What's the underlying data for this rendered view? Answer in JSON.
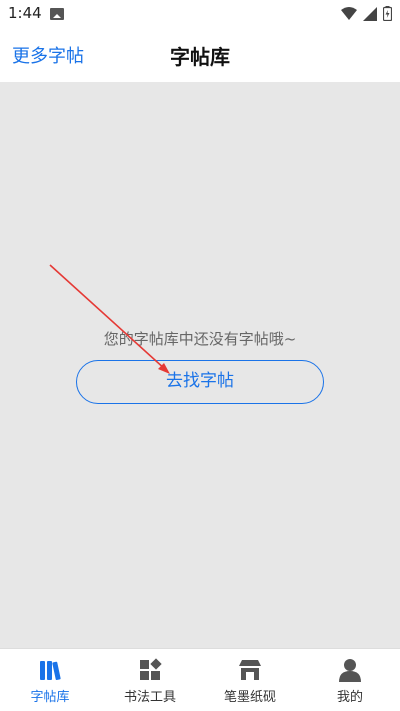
{
  "status_bar": {
    "time": "1:44",
    "icons": [
      "image-icon",
      "wifi-icon",
      "signal-icon",
      "battery-charging-icon"
    ]
  },
  "header": {
    "more_label": "更多字帖",
    "title": "字帖库"
  },
  "main": {
    "empty_message": "您的字帖库中还没有字帖哦~",
    "find_button_label": "去找字帖"
  },
  "tabbar": {
    "tabs": [
      {
        "label": "字帖库",
        "icon": "books-icon",
        "active": true
      },
      {
        "label": "书法工具",
        "icon": "grid-tools-icon",
        "active": false
      },
      {
        "label": "笔墨纸砚",
        "icon": "store-icon",
        "active": false
      },
      {
        "label": "我的",
        "icon": "person-icon",
        "active": false
      }
    ]
  },
  "colors": {
    "accent": "#1a73e8",
    "content_bg": "#e7e7e7",
    "annotation_arrow": "#e53935"
  }
}
